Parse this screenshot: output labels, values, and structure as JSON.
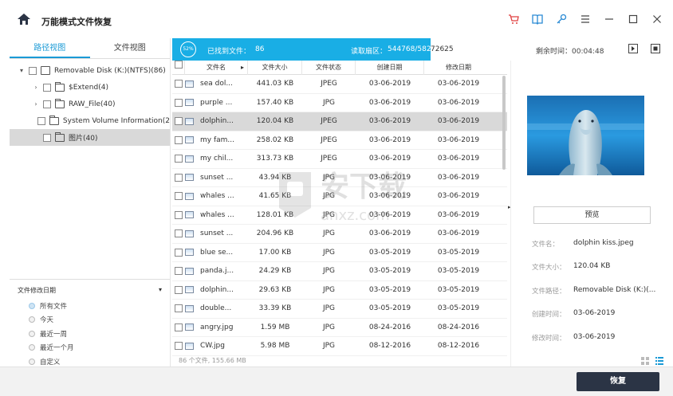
{
  "app": {
    "title": "万能模式文件恢复"
  },
  "toolbar": {
    "icons": [
      "cart-icon",
      "book-icon",
      "key-icon",
      "menu-icon",
      "minimize-icon",
      "maximize-icon",
      "close-icon"
    ]
  },
  "left_tabs": [
    {
      "label": "路径视图",
      "active": true
    },
    {
      "label": "文件视图",
      "active": false
    }
  ],
  "tree": [
    {
      "label": "Removable Disk (K:)(NTFS)(86)",
      "arrow": "▾",
      "type": "disk",
      "selected": false
    },
    {
      "label": "$Extend(4)",
      "arrow": "›",
      "type": "folder",
      "selected": false
    },
    {
      "label": "RAW_File(40)",
      "arrow": "›",
      "type": "folder",
      "selected": false
    },
    {
      "label": "System Volume Information(2",
      "arrow": "",
      "type": "folder",
      "selected": false
    },
    {
      "label": "图片(40)",
      "arrow": "",
      "type": "folder",
      "selected": true
    }
  ],
  "filter": {
    "title": "文件修改日期",
    "options": [
      {
        "label": "所有文件",
        "checked": true
      },
      {
        "label": "今天",
        "checked": false
      },
      {
        "label": "最近一周",
        "checked": false
      },
      {
        "label": "最近一个月",
        "checked": false
      },
      {
        "label": "自定义",
        "checked": false
      }
    ]
  },
  "progress": {
    "percent": "52%",
    "found_label": "已找到文件：",
    "found_count": "86",
    "read_label": "读取扇区：",
    "read_value": "544768/582",
    "read_rest": "72625",
    "progress_fraction": 0.52
  },
  "status": {
    "remaining": "剩余时间：00:04:48"
  },
  "table": {
    "headers": [
      "文件名",
      "文件大小",
      "文件状态",
      "创建日期",
      "修改日期"
    ],
    "rows": [
      [
        "sea dol...",
        "441.03  KB",
        "JPEG",
        "03-06-2019",
        "03-06-2019"
      ],
      [
        "purple ...",
        "157.40  KB",
        "JPG",
        "03-06-2019",
        "03-06-2019"
      ],
      [
        "dolphin...",
        "120.04  KB",
        "JPEG",
        "03-06-2019",
        "03-06-2019"
      ],
      [
        "my fam...",
        "258.02  KB",
        "JPEG",
        "03-06-2019",
        "03-06-2019"
      ],
      [
        "my chil...",
        "313.73  KB",
        "JPEG",
        "03-06-2019",
        "03-06-2019"
      ],
      [
        "sunset ...",
        "43.94  KB",
        "JPG",
        "03-06-2019",
        "03-06-2019"
      ],
      [
        "whales ...",
        "41.65  KB",
        "JPG",
        "03-06-2019",
        "03-06-2019"
      ],
      [
        "whales ...",
        "128.01  KB",
        "JPG",
        "03-06-2019",
        "03-06-2019"
      ],
      [
        "sunset ...",
        "204.96  KB",
        "JPG",
        "03-06-2019",
        "03-06-2019"
      ],
      [
        "blue se...",
        "17.00  KB",
        "JPG",
        "03-05-2019",
        "03-05-2019"
      ],
      [
        "panda.j...",
        "24.29  KB",
        "JPG",
        "03-05-2019",
        "03-05-2019"
      ],
      [
        "dolphin...",
        "29.63  KB",
        "JPG",
        "03-05-2019",
        "03-05-2019"
      ],
      [
        "double...",
        "33.39  KB",
        "JPG",
        "03-05-2019",
        "03-05-2019"
      ],
      [
        "angry.jpg",
        "1.59  MB",
        "JPG",
        "08-24-2016",
        "08-24-2016"
      ],
      [
        "CW.jpg",
        "5.98  MB",
        "JPG",
        "08-12-2016",
        "08-12-2016"
      ]
    ],
    "selected_row": 2,
    "footer": "86 个文件, 155.66  MB"
  },
  "preview": {
    "button": "预览",
    "info": [
      {
        "label": "文件名：",
        "value": "dolphin kiss.jpeg"
      },
      {
        "label": "文件大小：",
        "value": "120.04  KB"
      },
      {
        "label": "文件路径：",
        "value": "Removable Disk (K:)(..."
      },
      {
        "label": "创建时间：",
        "value": "03-06-2019"
      },
      {
        "label": "修改时间：",
        "value": "03-06-2019"
      }
    ]
  },
  "bottom": {
    "recover": "恢复"
  },
  "watermark": {
    "text": "anxz.com"
  },
  "colors": {
    "accent": "#19aee5",
    "button_dark": "#2b3445",
    "selected_row": "#d9d9d9"
  }
}
